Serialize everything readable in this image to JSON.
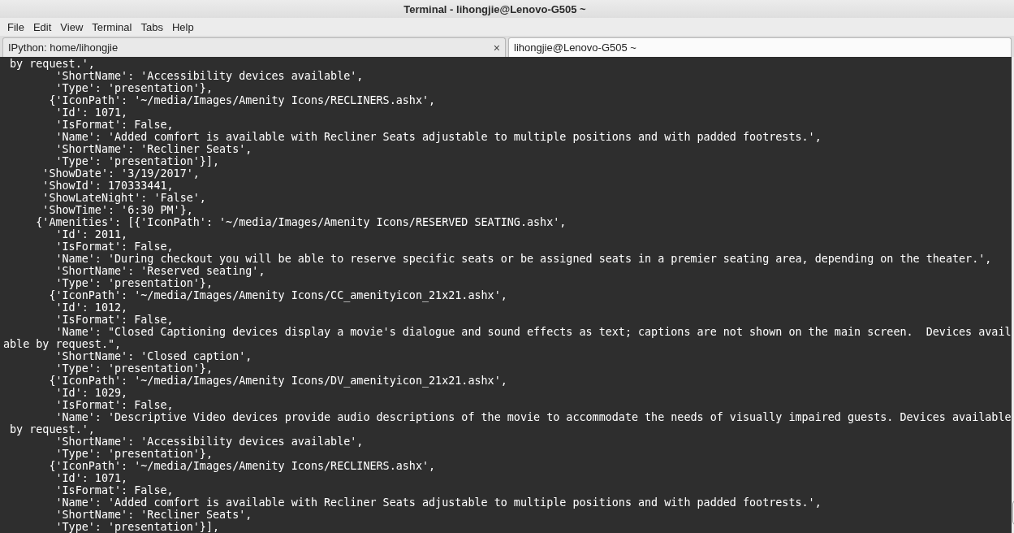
{
  "window": {
    "title": "Terminal - lihongjie@Lenovo-G505 ~"
  },
  "menu": [
    "File",
    "Edit",
    "View",
    "Terminal",
    "Tabs",
    "Help"
  ],
  "tabs": [
    {
      "label": "IPython: home/lihongjie",
      "selected": false,
      "closable": true,
      "close": "×"
    },
    {
      "label": "lihongjie@Lenovo-G505 ~",
      "selected": true,
      "closable": false
    }
  ],
  "terminal": {
    "lines": [
      " by request.',",
      "        'ShortName': 'Accessibility devices available',",
      "        'Type': 'presentation'},",
      "       {'IconPath': '~/media/Images/Amenity Icons/RECLINERS.ashx',",
      "        'Id': 1071,",
      "        'IsFormat': False,",
      "        'Name': 'Added comfort is available with Recliner Seats adjustable to multiple positions and with padded footrests.',",
      "        'ShortName': 'Recliner Seats',",
      "        'Type': 'presentation'}],",
      "      'ShowDate': '3/19/2017',",
      "      'ShowId': 170333441,",
      "      'ShowLateNight': 'False',",
      "      'ShowTime': '6:30 PM'},",
      "     {'Amenities': [{'IconPath': '~/media/Images/Amenity Icons/RESERVED SEATING.ashx',",
      "        'Id': 2011,",
      "        'IsFormat': False,",
      "        'Name': 'During checkout you will be able to reserve specific seats or be assigned seats in a premier seating area, depending on the theater.',",
      "        'ShortName': 'Reserved seating',",
      "        'Type': 'presentation'},",
      "       {'IconPath': '~/media/Images/Amenity Icons/CC_amenityicon_21x21.ashx',",
      "        'Id': 1012,",
      "        'IsFormat': False,",
      "        'Name': \"Closed Captioning devices display a movie's dialogue and sound effects as text; captions are not shown on the main screen.  Devices avail",
      "able by request.\",",
      "        'ShortName': 'Closed caption',",
      "        'Type': 'presentation'},",
      "       {'IconPath': '~/media/Images/Amenity Icons/DV_amenityicon_21x21.ashx',",
      "        'Id': 1029,",
      "        'IsFormat': False,",
      "        'Name': 'Descriptive Video devices provide audio descriptions of the movie to accommodate the needs of visually impaired guests. Devices available",
      " by request.',",
      "        'ShortName': 'Accessibility devices available',",
      "        'Type': 'presentation'},",
      "       {'IconPath': '~/media/Images/Amenity Icons/RECLINERS.ashx',",
      "        'Id': 1071,",
      "        'IsFormat': False,",
      "        'Name': 'Added comfort is available with Recliner Seats adjustable to multiple positions and with padded footrests.',",
      "        'ShortName': 'Recliner Seats',",
      "        'Type': 'presentation'}],"
    ]
  }
}
